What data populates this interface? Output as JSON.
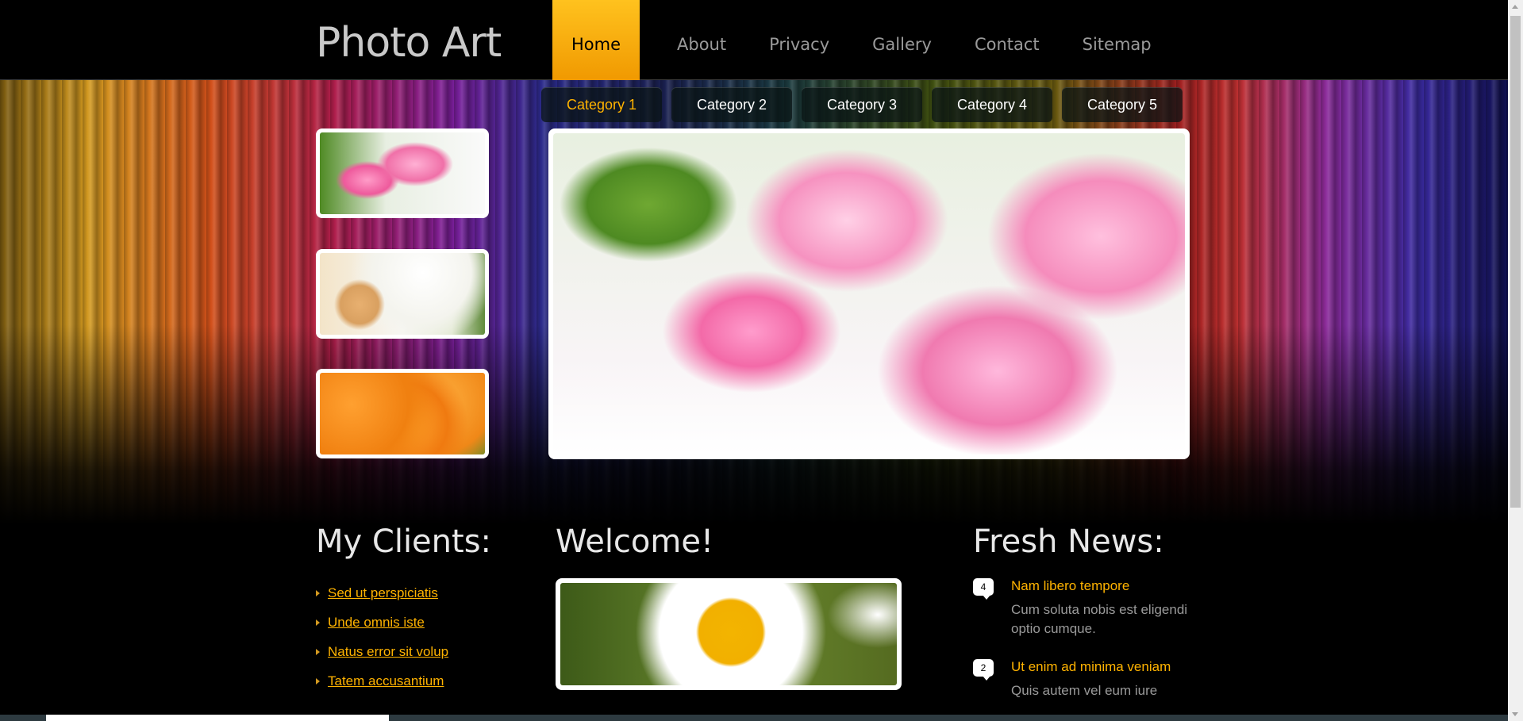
{
  "header": {
    "logo": "Photo Art",
    "nav": [
      "Home",
      "About",
      "Privacy",
      "Gallery",
      "Contact",
      "Sitemap"
    ],
    "active_nav": "Home"
  },
  "categories": [
    "Category 1",
    "Category 2",
    "Category 3",
    "Category 4",
    "Category 5"
  ],
  "clients": {
    "heading": "My Clients:",
    "links": [
      "Sed ut perspiciatis",
      "Unde omnis iste",
      "Natus error sit volup",
      "Tatem accusantium"
    ]
  },
  "welcome": {
    "heading": "Welcome!"
  },
  "news": {
    "heading": "Fresh News:",
    "items": [
      {
        "count": "4",
        "title": "Nam libero tempore",
        "body": "Cum soluta nobis est eligendi optio cumque."
      },
      {
        "count": "2",
        "title": "Ut enim ad minima veniam",
        "body": "Quis autem vel eum iure"
      }
    ]
  },
  "colors": {
    "accent": "#ffb300",
    "nav_active": "#f5a800"
  }
}
